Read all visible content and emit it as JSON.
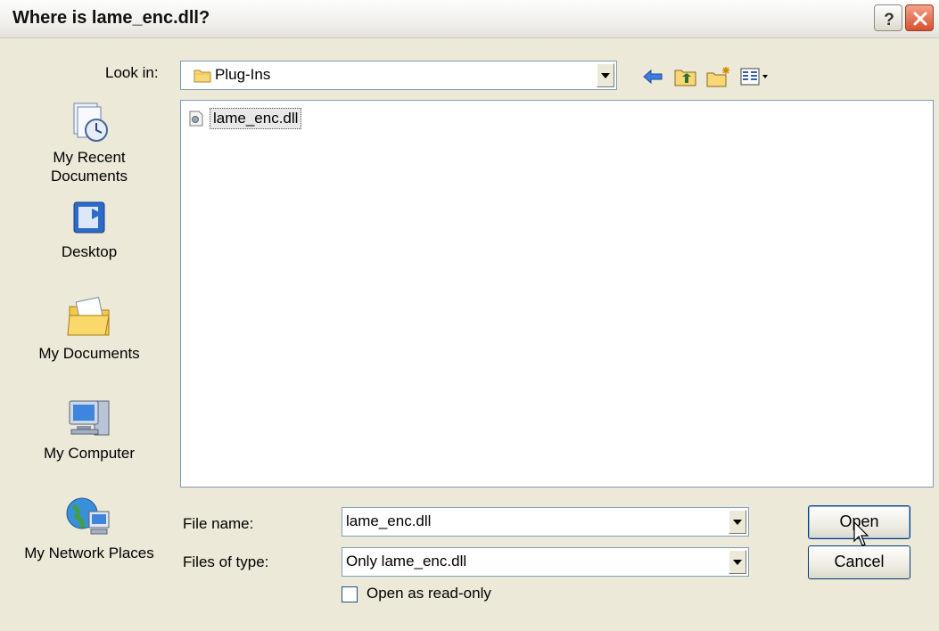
{
  "window": {
    "title": "Where is lame_enc.dll?"
  },
  "title_buttons": {
    "help_icon": "help-icon",
    "close_icon": "close-icon"
  },
  "look_in": {
    "label": "Look in:",
    "value": "Plug-Ins",
    "icon": "folder-icon"
  },
  "toolbar": [
    {
      "icon": "back-arrow-icon"
    },
    {
      "icon": "up-one-level-icon"
    },
    {
      "icon": "create-new-folder-icon"
    },
    {
      "icon": "view-menu-icon"
    }
  ],
  "places": [
    {
      "label": "My Recent Documents",
      "icon": "recent-documents-icon"
    },
    {
      "label": "Desktop",
      "icon": "desktop-icon"
    },
    {
      "label": "My Documents",
      "icon": "my-documents-icon"
    },
    {
      "label": "My Computer",
      "icon": "my-computer-icon"
    },
    {
      "label": "My Network Places",
      "icon": "network-places-icon"
    }
  ],
  "files": [
    {
      "name": "lame_enc.dll",
      "icon": "dll-file-icon",
      "selected": true
    }
  ],
  "file_name": {
    "label": "File name:",
    "value": "lame_enc.dll"
  },
  "file_type": {
    "label": "Files of type:",
    "value": "Only lame_enc.dll"
  },
  "buttons": {
    "open": "Open",
    "cancel": "Cancel"
  },
  "readonly": {
    "label": "Open as read-only",
    "checked": false
  },
  "colors": {
    "selection_bg": "#e8e8e8",
    "border_blue": "#7f9db9",
    "dialog_bg": "#ece9d8"
  }
}
